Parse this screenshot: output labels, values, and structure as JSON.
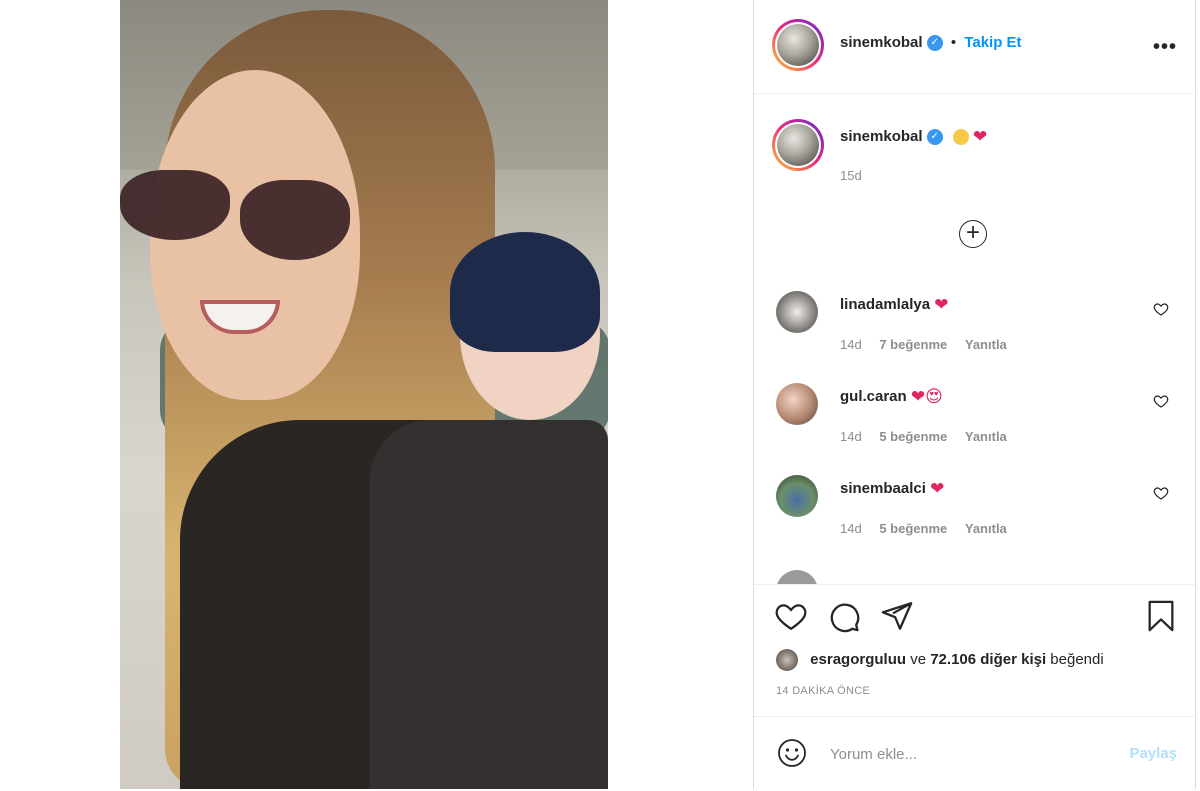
{
  "post": {
    "author": "sinemkobal",
    "follow_label": "Takip Et",
    "more_label": "•••",
    "caption_time": "15d",
    "expand_label": "+"
  },
  "comments": [
    {
      "user": "linadamlalya",
      "emoji": "❤",
      "time": "14d",
      "likes": "7 beğenme",
      "reply": "Yanıtla"
    },
    {
      "user": "gul.caran",
      "emoji": "❤😍",
      "time": "14d",
      "likes": "5 beğenme",
      "reply": "Yanıtla"
    },
    {
      "user": "sinembaalci",
      "emoji": "❤",
      "time": "14d",
      "likes": "5 beğenme",
      "reply": "Yanıtla"
    }
  ],
  "likes": {
    "first_user": "esragorguluu",
    "connector": "ve",
    "others": "72.106 diğer kişi",
    "suffix": "beğendi"
  },
  "timestamp": "14 DAKİKA ÖNCE",
  "comment_box": {
    "placeholder": "Yorum ekle...",
    "share_label": "Paylaş"
  },
  "icons": {
    "verified": "verified-badge-icon",
    "more": "more-options-icon",
    "like": "heart-icon",
    "comment": "comment-bubble-icon",
    "share": "send-arrow-icon",
    "save": "bookmark-icon",
    "emoji": "smiley-icon"
  },
  "colors": {
    "accent": "#0095f6",
    "verified": "#3897f0",
    "heart": "#e0245e",
    "muted": "#8e8e8e",
    "share_disabled": "#b2dffc"
  }
}
